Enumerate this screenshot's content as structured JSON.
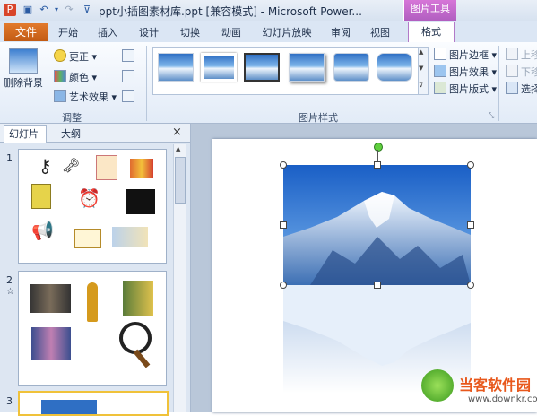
{
  "window": {
    "title": "ppt小插图素材库.ppt [兼容模式] - Microsoft Power...",
    "context_group": "图片工具"
  },
  "tabs": {
    "file": "文件",
    "items": [
      "开始",
      "插入",
      "设计",
      "切换",
      "动画",
      "幻灯片放映",
      "审阅",
      "视图"
    ],
    "active": "格式"
  },
  "ribbon": {
    "adjust": {
      "remove_bg": "删除背景",
      "corrections": "更正",
      "color": "颜色",
      "artistic": "艺术效果",
      "label": "调整"
    },
    "styles": {
      "label": "图片样式",
      "border": "图片边框",
      "effects": "图片效果",
      "layout": "图片版式"
    },
    "arrange": {
      "bring_forward": "上移",
      "send_backward": "下移",
      "selection_pane": "选择"
    }
  },
  "panel": {
    "tab_slides": "幻灯片",
    "tab_outline": "大纲",
    "close": "×",
    "slide_numbers": [
      "1",
      "2",
      "3"
    ],
    "slide2_star": "☆"
  },
  "watermark": {
    "text": "当客软件园",
    "url": "www.downkr.com"
  },
  "colors": {
    "file_tab": "#c25b14",
    "context_tab": "#b15fc0",
    "accent_blue": "#2a5ba3"
  }
}
